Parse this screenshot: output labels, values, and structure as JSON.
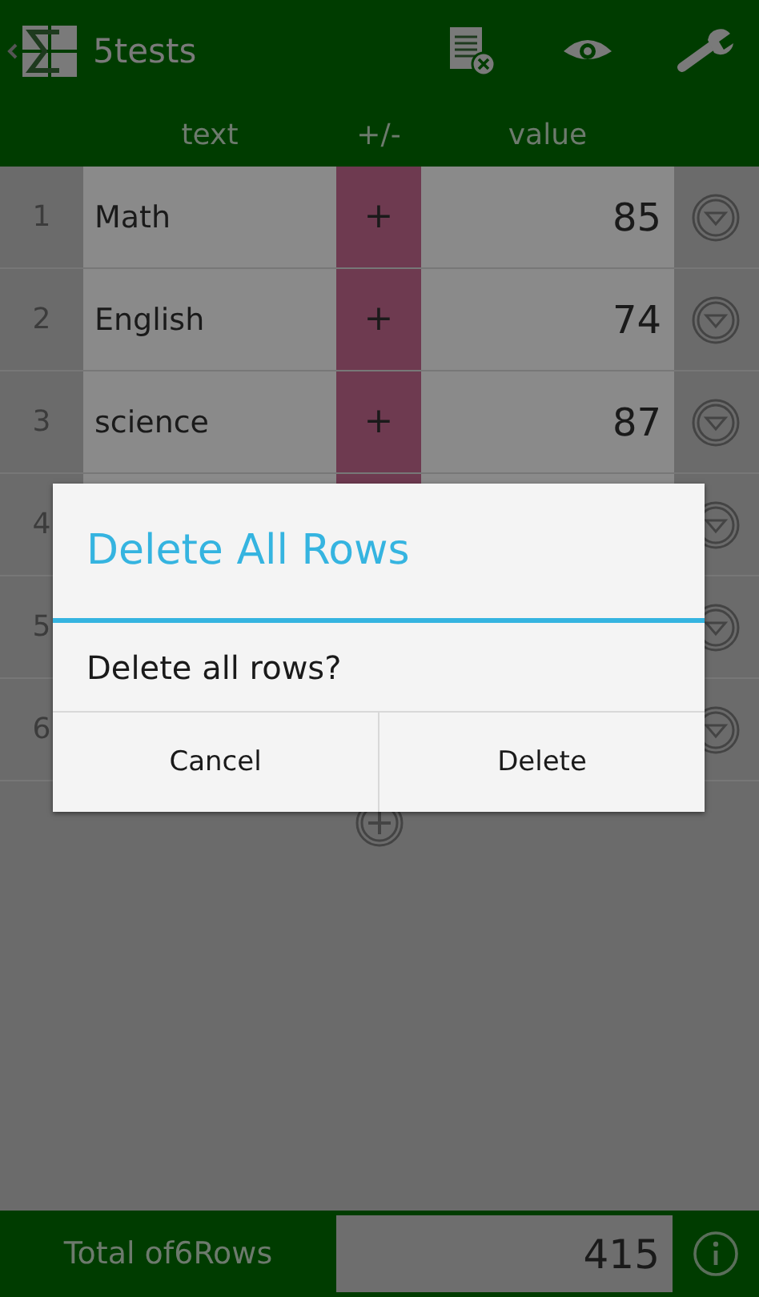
{
  "app_bar": {
    "title": "5tests"
  },
  "columns": [
    "text",
    "+/-",
    "value"
  ],
  "rows": [
    {
      "number": "1",
      "text": "Math",
      "sign": "+",
      "value": "85"
    },
    {
      "number": "2",
      "text": "English",
      "sign": "+",
      "value": "74"
    },
    {
      "number": "3",
      "text": "science",
      "sign": "+",
      "value": "87"
    },
    {
      "number": "4"
    },
    {
      "number": "5"
    },
    {
      "number": "6"
    }
  ],
  "footer": {
    "label": "Total of6Rows",
    "value": "415"
  },
  "dialog": {
    "title": "Delete All Rows",
    "message": "Delete all rows?",
    "buttons": [
      "Cancel",
      "Delete"
    ]
  }
}
